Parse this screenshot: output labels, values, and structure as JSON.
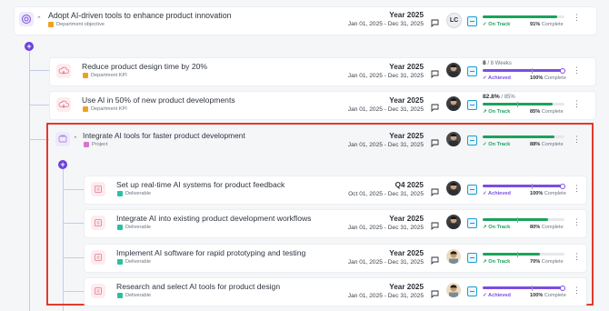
{
  "colors": {
    "track_green": "#1aa35b",
    "achieved_purple": "#7b4ee0",
    "highlight_red": "#e03a2e",
    "plus_purple": "#6d3fe0"
  },
  "objective": {
    "title": "Adopt AI-driven tools to enhance product innovation",
    "tag": "Department objective",
    "period": "Year 2025",
    "dates": "Jan 01, 2025 - Dec 31, 2025",
    "owner_initials": "LC",
    "status": "On Track",
    "percent": "91%",
    "percent_suffix": "Complete",
    "progress": 0.91
  },
  "kpis": [
    {
      "title": "Reduce product design time by 20%",
      "tag": "Department KPI",
      "period": "Year 2025",
      "dates": "Jan 01, 2025 - Dec 31, 2025",
      "metric_value": "8",
      "metric_target": "/ 8 Weeks",
      "status": "Achieved",
      "percent": "100%",
      "percent_suffix": "Complete",
      "progress": 1.0
    },
    {
      "title": "Use AI in 50% of new product developments",
      "tag": "Department KPI",
      "period": "Year 2025",
      "dates": "Jan 01, 2025 - Dec 31, 2025",
      "metric_value": "82.8%",
      "metric_target": "/ 85%",
      "status": "On Track",
      "percent": "85%",
      "percent_suffix": "Complete",
      "progress": 0.85
    }
  ],
  "project": {
    "title": "Integrate AI tools for faster product development",
    "tag": "Project",
    "period": "Year 2025",
    "dates": "Jan 01, 2025 - Dec 31, 2025",
    "status": "On Track",
    "percent": "88%",
    "percent_suffix": "Complete",
    "progress": 0.88
  },
  "deliverables": [
    {
      "title": "Set up real-time AI systems for product feedback",
      "tag": "Deliverable",
      "period": "Q4 2025",
      "dates": "Oct 01, 2025 - Dec 31, 2025",
      "status": "Achieved",
      "percent": "100%",
      "percent_suffix": "Complete",
      "progress": 1.0
    },
    {
      "title": "Integrate AI into existing product development workflows",
      "tag": "Deliverable",
      "period": "Year 2025",
      "dates": "Jan 01, 2025 - Dec 31, 2025",
      "status": "On Track",
      "percent": "80%",
      "percent_suffix": "Complete",
      "progress": 0.8
    },
    {
      "title": "Implement AI software for rapid prototyping and testing",
      "tag": "Deliverable",
      "period": "Year 2025",
      "dates": "Jan 01, 2025 - Dec 31, 2025",
      "status": "On Track",
      "percent": "70%",
      "percent_suffix": "Complete",
      "progress": 0.7
    },
    {
      "title": "Research and select AI tools for product design",
      "tag": "Deliverable",
      "period": "Year 2025",
      "dates": "Jan 01, 2025 - Dec 31, 2025",
      "status": "Achieved",
      "percent": "100%",
      "percent_suffix": "Complete",
      "progress": 1.0
    }
  ]
}
